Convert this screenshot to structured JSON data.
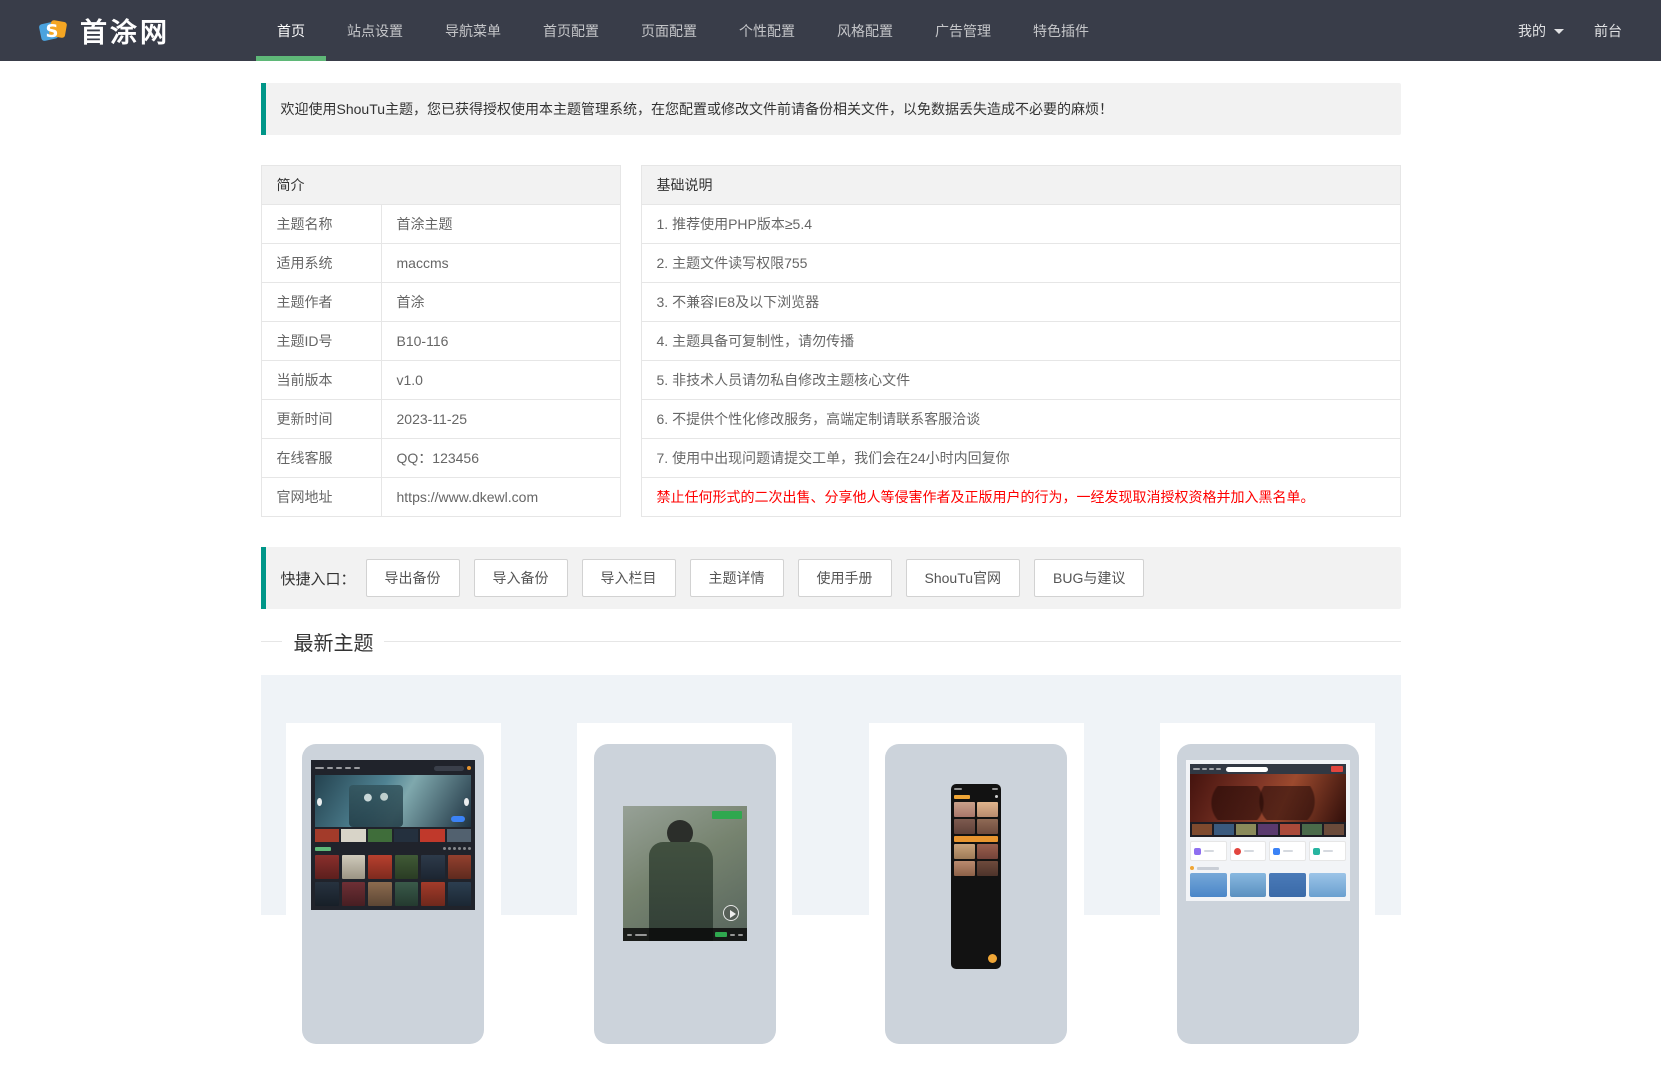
{
  "navbar": {
    "logo_text": "首涂网",
    "items": [
      {
        "label": "首页",
        "active": true
      },
      {
        "label": "站点设置"
      },
      {
        "label": "导航菜单"
      },
      {
        "label": "首页配置"
      },
      {
        "label": "页面配置"
      },
      {
        "label": "个性配置"
      },
      {
        "label": "风格配置"
      },
      {
        "label": "广告管理"
      },
      {
        "label": "特色插件"
      }
    ],
    "my_label": "我的",
    "front_label": "前台"
  },
  "alert": {
    "text": "欢迎使用ShouTu主题，您已获得授权使用本主题管理系统，在您配置或修改文件前请备份相关文件，以免数据丢失造成不必要的麻烦！"
  },
  "intro_table": {
    "header": "简介",
    "rows": [
      {
        "label": "主题名称",
        "value": "首涂主题"
      },
      {
        "label": "适用系统",
        "value": "maccms"
      },
      {
        "label": "主题作者",
        "value": "首涂"
      },
      {
        "label": "主题ID号",
        "value": "B10-116"
      },
      {
        "label": "当前版本",
        "value": "v1.0"
      },
      {
        "label": "更新时间",
        "value": "2023-11-25"
      },
      {
        "label": "在线客服",
        "value": "QQ：123456"
      },
      {
        "label": "官网地址",
        "value": "https://www.dkewl.com"
      }
    ]
  },
  "notes_table": {
    "header": "基础说明",
    "rows": [
      "1. 推荐使用PHP版本≥5.4",
      "2. 主题文件读写权限755",
      "3. 不兼容IE8及以下浏览器",
      "4. 主题具备可复制性，请勿传播",
      "5. 非技术人员请勿私自修改主题核心文件",
      "6. 不提供个性化修改服务，高端定制请联系客服洽谈",
      "7. 使用中出现问题请提交工单，我们会在24小时内回复你"
    ],
    "warning": "禁止任何形式的二次出售、分享他人等侵害作者及正版用户的行为，一经发现取消授权资格并加入黑名单。"
  },
  "quick_entry": {
    "label": "快捷入口：",
    "buttons": [
      "导出备份",
      "导入备份",
      "导入栏目",
      "主题详情",
      "使用手册",
      "ShouTu官网",
      "BUG与建议"
    ]
  },
  "latest_themes": {
    "title": "最新主题",
    "count": 4
  },
  "colors": {
    "navbar_bg": "#393D49",
    "nav_active_bar": "#5FB878",
    "quote_border": "#009688",
    "quote_bg": "#f2f2f2",
    "table_border": "#e6e6e6",
    "warning_text": "#ff0000",
    "panel_bg": "#eff3f7",
    "logo_blue": "#4aa3df",
    "logo_orange": "#f5a623"
  }
}
